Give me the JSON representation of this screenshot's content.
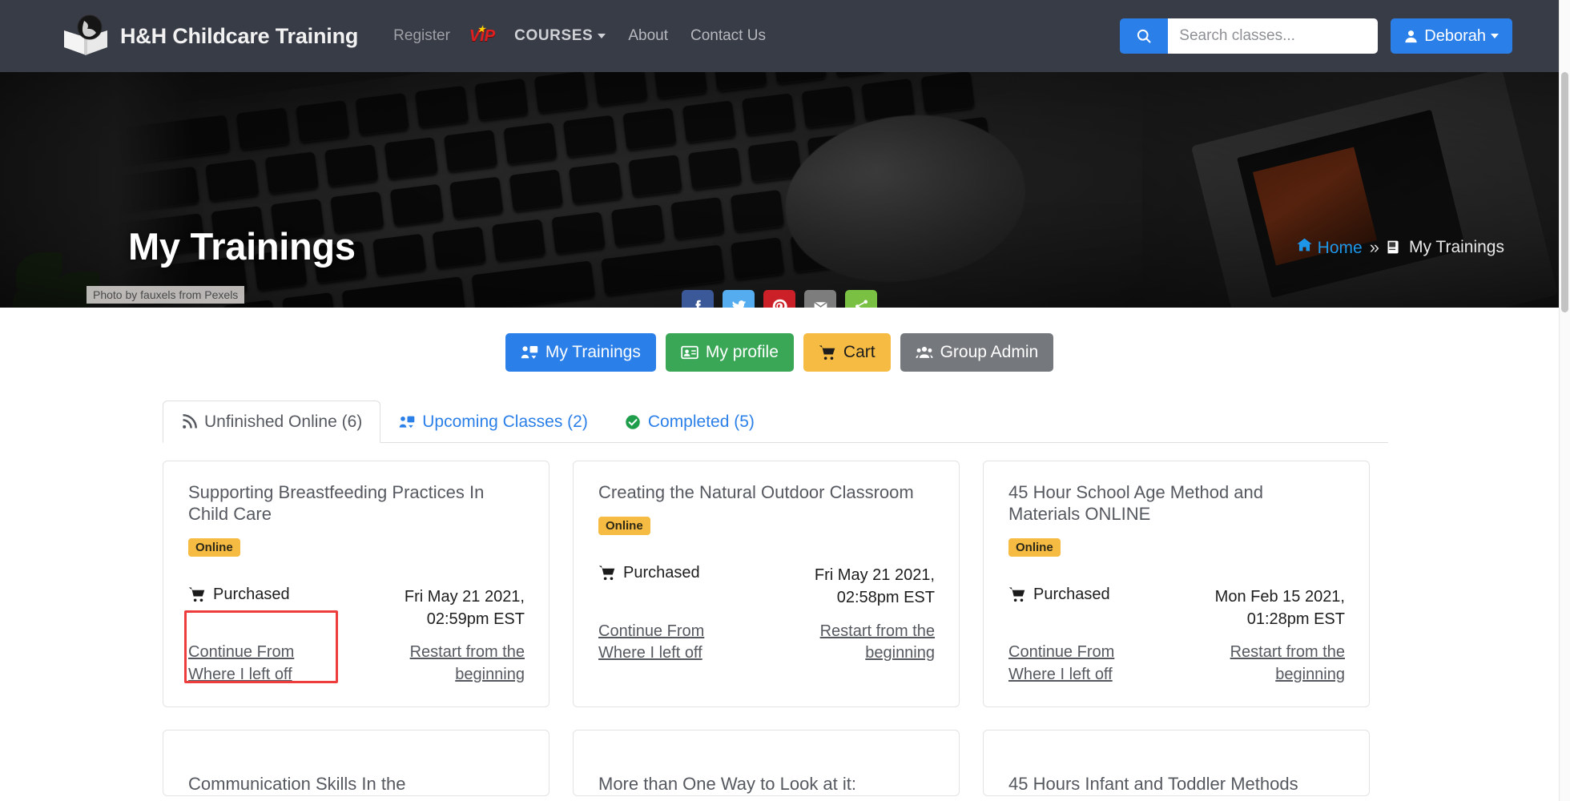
{
  "navbar": {
    "brand": "H&H Childcare Training",
    "logo_icon": "open-book-globe-logo",
    "links": [
      {
        "label": "Register",
        "icon": ""
      },
      {
        "label": "VIP",
        "icon": "vip-star-icon"
      },
      {
        "label": "COURSES",
        "icon": "chevron-down-icon"
      },
      {
        "label": "About",
        "icon": ""
      },
      {
        "label": "Contact Us",
        "icon": ""
      }
    ],
    "search": {
      "placeholder": "Search classes...",
      "value": "",
      "icon": "search-icon"
    },
    "user": {
      "name": "Deborah",
      "icon": "user-icon",
      "caret": "chevron-down-icon"
    },
    "background_color": "#383c47",
    "accent_color": "#2a7fe8"
  },
  "hero": {
    "title": "My Trainings",
    "photo_credit": "Photo by fauxels from Pexels",
    "breadcrumb": {
      "home_icon": "home-icon",
      "home_label": "Home",
      "separator": "»",
      "current_icon": "book-icon",
      "current_label": "My Trainings",
      "link_color": "#1e96e8"
    },
    "social": [
      {
        "name": "facebook-share-button",
        "glyph": "f",
        "color": "#3b5998"
      },
      {
        "name": "twitter-share-button",
        "glyph": "t",
        "color": "#55acee"
      },
      {
        "name": "pinterest-share-button",
        "glyph": "p",
        "color": "#cb2027"
      },
      {
        "name": "email-share-button",
        "glyph": "m",
        "color": "#7d7d7d"
      },
      {
        "name": "more-share-button",
        "glyph": "s",
        "color": "#7ac143"
      }
    ]
  },
  "actions": [
    {
      "label": "My Trainings",
      "icon": "trainings-icon",
      "color": "#2a7fe8"
    },
    {
      "label": "My profile",
      "icon": "profile-card-icon",
      "color": "#3aa757"
    },
    {
      "label": "Cart",
      "icon": "cart-icon",
      "color": "#f6bb42"
    },
    {
      "label": "Group Admin",
      "icon": "users-icon",
      "color": "#75787d"
    }
  ],
  "tabs": [
    {
      "label": "Unfinished Online (6)",
      "icon": "rss-icon",
      "active": true
    },
    {
      "label": "Upcoming Classes (2)",
      "icon": "trainings-icon",
      "active": false
    },
    {
      "label": "Completed (5)",
      "icon": "check-circle-icon",
      "active": false
    }
  ],
  "cards": [
    {
      "title": "Supporting Breastfeeding Practices In Child Care",
      "badge": "Online",
      "status": "Purchased",
      "status_icon": "cart-icon",
      "date": "Fri May 21 2021, 02:59pm EST",
      "continue_label": "Continue From Where I left off",
      "restart_label": "Restart from the beginning",
      "highlighted": true,
      "highlight_color": "#ee3b3b"
    },
    {
      "title": "Creating the Natural Outdoor Classroom",
      "badge": "Online",
      "status": "Purchased",
      "status_icon": "cart-icon",
      "date": "Fri May 21 2021, 02:58pm EST",
      "continue_label": "Continue From Where I left off",
      "restart_label": "Restart from the beginning",
      "highlighted": false
    },
    {
      "title": "45 Hour School Age Method and Materials ONLINE",
      "badge": "Online",
      "status": "Purchased",
      "status_icon": "cart-icon",
      "date": "Mon Feb 15 2021, 01:28pm EST",
      "continue_label": "Continue From Where I left off",
      "restart_label": "Restart from the beginning",
      "highlighted": false
    }
  ],
  "cards_row2": [
    {
      "title": "Communication Skills In the"
    },
    {
      "title": "More than One Way to Look at it:"
    },
    {
      "title": "45 Hours Infant and Toddler Methods"
    }
  ]
}
